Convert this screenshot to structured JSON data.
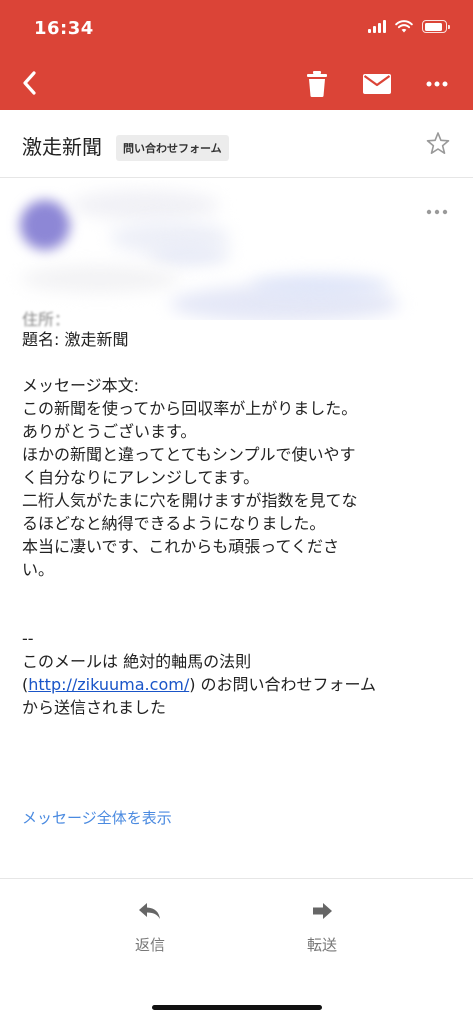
{
  "status_bar": {
    "time": "16:34",
    "battery_level": 0.85
  },
  "toolbar": {
    "back_icon": "chevron-left-icon",
    "trash_icon": "trash-icon",
    "mail_icon": "envelope-icon",
    "more_icon": "more-horizontal-icon"
  },
  "message": {
    "subject": "激走新聞",
    "label": "問い合わせフォーム",
    "body_lines": {
      "partial": "住所：",
      "subject_line": "題名: 激走新聞",
      "heading": "メッセージ本文:",
      "l1": "この新聞を使ってから回収率が上がりました。",
      "l2": "ありがとうございます。",
      "l3": "ほかの新聞と違ってとてもシンプルで使いやす",
      "l4": "く自分なりにアレンジしてます。",
      "l5": "二桁人気がたまに穴を開けますが指数を見てな",
      "l6": "るほどなと納得できるようになりました。",
      "l7": "本当に凄いです、これからも頑張ってくださ",
      "l8": "い。",
      "sig_sep": "--",
      "sig1": "このメールは 絶対的軸馬の法則",
      "sig2_open": "(",
      "sig2_link": "http://zikuuma.com/",
      "sig2_rest": ") のお問い合わせフォーム",
      "sig3": "から送信されました"
    },
    "show_full": "メッセージ全体を表示"
  },
  "footer": {
    "reply_label": "返信",
    "forward_label": "転送"
  },
  "colors": {
    "accent": "#db4437",
    "link": "#1a55c8",
    "show_full": "#4a8ae0"
  }
}
